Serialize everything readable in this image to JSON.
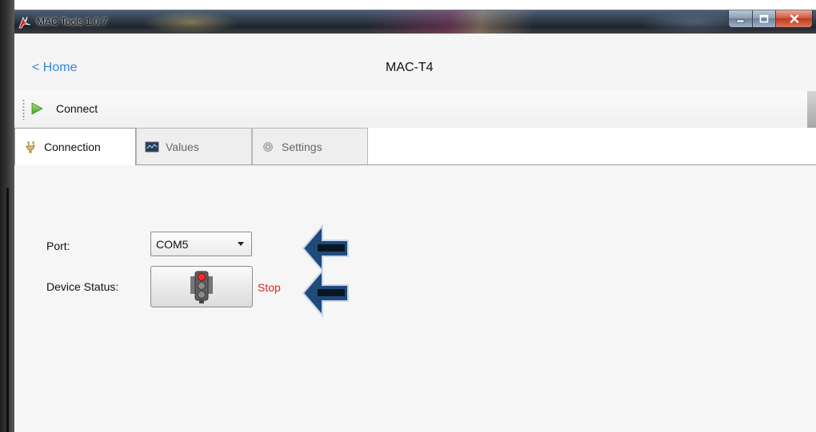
{
  "window": {
    "title": "MAC Tools 1.0.7",
    "controls": [
      "minimize",
      "maximize",
      "close"
    ]
  },
  "header": {
    "back_link": "< Home",
    "title": "MAC-T4"
  },
  "toolbar": {
    "connect_label": "Connect"
  },
  "tabs": [
    {
      "label": "Connection",
      "icon": "connection-icon",
      "active": true
    },
    {
      "label": "Values",
      "icon": "values-icon",
      "active": false
    },
    {
      "label": "Settings",
      "icon": "settings-icon",
      "active": false
    }
  ],
  "connection": {
    "port_label": "Port:",
    "port_value": "COM5",
    "device_status_label": "Device Status:",
    "device_status": "Stop",
    "status_icon": "traffic-light-red-icon"
  },
  "colors": {
    "link": "#2f87d9",
    "stop": "#e52323",
    "arrow": "#1f4a7a"
  }
}
